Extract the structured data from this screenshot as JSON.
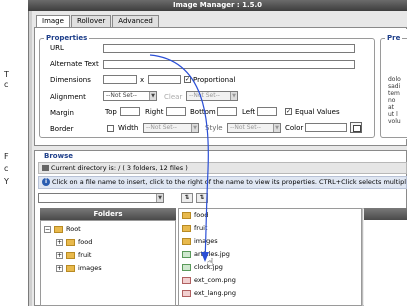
{
  "window": {
    "title": "Image Manager : 1.5.0"
  },
  "tabs": [
    {
      "label": "Image",
      "active": true
    },
    {
      "label": "Rollover",
      "active": false
    },
    {
      "label": "Advanced",
      "active": false
    }
  ],
  "properties": {
    "legend": "Properties",
    "url_label": "URL",
    "url_value": "",
    "alt_label": "Alternate Text",
    "alt_value": "",
    "dimensions_label": "Dimensions",
    "dimensions_sep": "x",
    "proportional_label": "Proportional",
    "alignment_label": "Alignment",
    "alignment_value": "--Not Set--",
    "clear_label": "Clear",
    "clear_value": "--Not Set--",
    "margin_label": "Margin",
    "top_label": "Top",
    "right_label": "Right",
    "bottom_label": "Bottom",
    "left_label": "Left",
    "equal_values_label": "Equal Values",
    "border_label": "Border",
    "width_label": "Width",
    "width_value": "--Not Set--",
    "style_label": "Style",
    "style_value": "--Not Set--",
    "color_label": "Color"
  },
  "preview": {
    "legend": "Pre",
    "text_lines": [
      "dolo",
      "sadi",
      "tem",
      "no",
      "at",
      "ut l",
      "volu"
    ]
  },
  "browse": {
    "legend": "Browse",
    "current_dir": "Current directory is: / ( 3 folders, 12 files )",
    "info": "Click on a file name to insert, click to the right of the name to view its properties. CTRL+Click selects multiple files",
    "info_icon": "info-icon"
  },
  "folders": {
    "header": "Folders",
    "root": "Root",
    "items": [
      "food",
      "fruit",
      "images"
    ]
  },
  "files": [
    {
      "name": "food",
      "kind": "folder"
    },
    {
      "name": "fruit",
      "kind": "folder"
    },
    {
      "name": "images",
      "kind": "folder"
    },
    {
      "name": "articles.jpg",
      "kind": "image"
    },
    {
      "name": "clock.jpg",
      "kind": "image"
    },
    {
      "name": "ext_com.png",
      "kind": "ext"
    },
    {
      "name": "ext_lang.png",
      "kind": "ext"
    }
  ],
  "background_page": {
    "left_chars": [
      "T",
      "c",
      "F",
      "c",
      "Y"
    ]
  }
}
